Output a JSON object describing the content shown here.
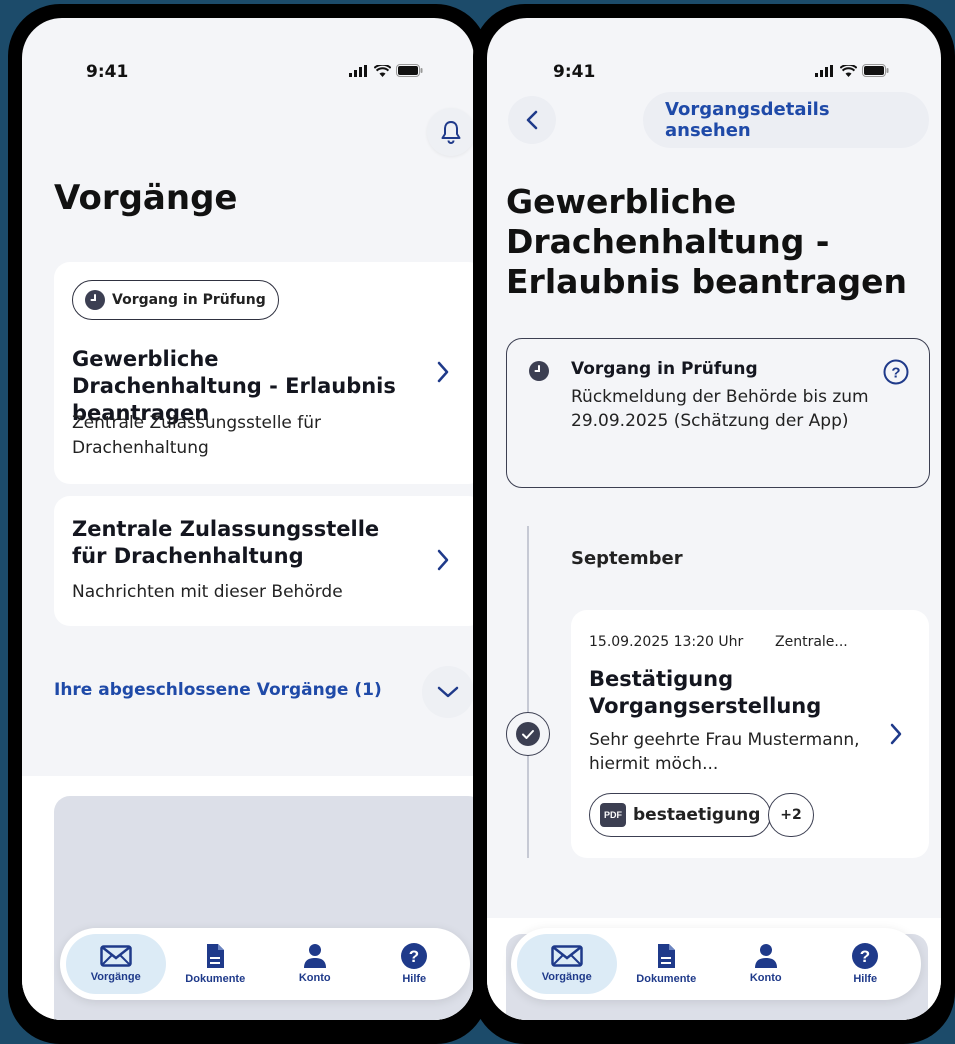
{
  "left": {
    "status": {
      "time": "9:41"
    },
    "title": "Vorgänge",
    "card1": {
      "badge": "Vorgang in Prüfung",
      "title": "Gewerbliche Drachenhaltung - Erlaubnis beantragen",
      "subtitle": "Zentrale Zulassungsstelle für Drachenhaltung"
    },
    "card2": {
      "title": "Zentrale Zulassungsstelle für Drachenhaltung",
      "subtitle": "Nachrichten mit dieser Behörde"
    },
    "completed_link": "Ihre abgeschlossene Vorgänge (1)"
  },
  "right": {
    "status": {
      "time": "9:41"
    },
    "details_button": "Vorgangsdetails ansehen",
    "title": "Gewerbliche Drachenhaltung - Erlaubnis beantragen",
    "status_box": {
      "title": "Vorgang in Prüfung",
      "text": "Rückmeldung der Behörde bis zum 29.09.2025 (Schätzung der App)"
    },
    "timeline": {
      "month": "September",
      "message": {
        "datetime": "15.09.2025 13:20 Uhr",
        "sender": "Zentrale...",
        "title": "Bestätigung Vorgangserstellung",
        "preview": "Sehr geehrte Frau Mustermann, hiermit möch...",
        "attachment_type": "PDF",
        "attachment_name": "bestaetigung",
        "more_count": "+2"
      }
    }
  },
  "tabs": [
    {
      "label": "Vorgänge",
      "icon": "mail-icon",
      "active": true
    },
    {
      "label": "Dokumente",
      "icon": "document-icon",
      "active": false
    },
    {
      "label": "Konto",
      "icon": "person-icon",
      "active": false
    },
    {
      "label": "Hilfe",
      "icon": "help-icon",
      "active": false
    }
  ],
  "colors": {
    "background": "#1c4b6a",
    "screen": "#f4f5f8",
    "accent": "#1f4aa8",
    "tab_active": "#dcebf6",
    "dark": "#3c3f52"
  }
}
